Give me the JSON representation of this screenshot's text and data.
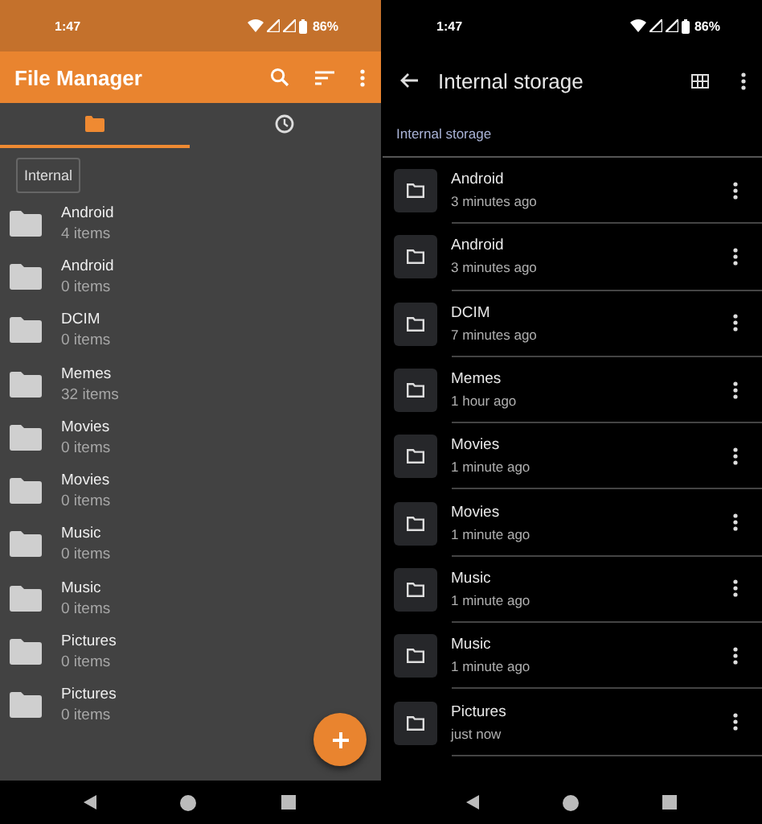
{
  "left_screen": {
    "status_bar": {
      "time": "1:47",
      "battery": "86%"
    },
    "app_bar": {
      "title": "File Manager"
    },
    "tabs": [
      {
        "selected": true
      },
      {
        "selected": false
      }
    ],
    "path_chip": "Internal",
    "folders": [
      {
        "name": "Android",
        "count": "4 items"
      },
      {
        "name": "Android",
        "count": "0 items"
      },
      {
        "name": "DCIM",
        "count": "0 items"
      },
      {
        "name": "Memes",
        "count": "32 items"
      },
      {
        "name": "Movies",
        "count": "0 items"
      },
      {
        "name": "Movies",
        "count": "0 items"
      },
      {
        "name": "Music",
        "count": "0 items"
      },
      {
        "name": "Music",
        "count": "0 items"
      },
      {
        "name": "Pictures",
        "count": "0 items"
      },
      {
        "name": "Pictures",
        "count": "0 items"
      }
    ]
  },
  "right_screen": {
    "status_bar": {
      "time": "1:47",
      "battery": "86%"
    },
    "app_bar": {
      "title": "Internal storage"
    },
    "breadcrumb": "Internal storage",
    "folders": [
      {
        "name": "Android",
        "modified": "3 minutes ago"
      },
      {
        "name": "Android",
        "modified": "3 minutes ago"
      },
      {
        "name": "DCIM",
        "modified": "7 minutes ago"
      },
      {
        "name": "Memes",
        "modified": "1 hour ago"
      },
      {
        "name": "Movies",
        "modified": "1 minute ago"
      },
      {
        "name": "Movies",
        "modified": "1 minute ago"
      },
      {
        "name": "Music",
        "modified": "1 minute ago"
      },
      {
        "name": "Music",
        "modified": "1 minute ago"
      },
      {
        "name": "Pictures",
        "modified": "just now"
      }
    ]
  }
}
